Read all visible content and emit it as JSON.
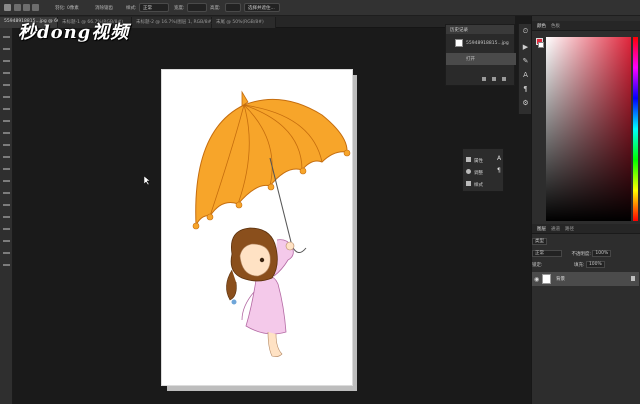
{
  "options_bar": {
    "items": [
      "羽化: 0像素",
      "消除锯齿",
      "样式:",
      "正常",
      "宽度:",
      "高度:",
      "选择并遮住..."
    ],
    "style_value": "正常",
    "refine_button": "选择并遮住..."
  },
  "doc_tabs": [
    "55948918815...jpg @ 66.7%(RGB/8#)",
    "未标题-1 @ 66.7%(RGB/8#)",
    "未标题-2 @ 16.7%(图层 1, RGB/8#)",
    "末尾 @ 50%(RGB/8#)"
  ],
  "watermark": "秒dong视频",
  "history_panel": {
    "title": "历史记录",
    "file_name": "55948918815...jpg",
    "step": "打开"
  },
  "float_panel": {
    "items": [
      {
        "label": "属性",
        "icon": "properties-icon"
      },
      {
        "label": "调整",
        "icon": "adjustments-icon"
      },
      {
        "label": "样式",
        "icon": "styles-icon"
      }
    ]
  },
  "right_panel": {
    "color_tabs": [
      "颜色",
      "色板"
    ],
    "layer_tabs": [
      "图层",
      "通道",
      "路径"
    ],
    "kind_label": "类型",
    "blend_mode": "正常",
    "opacity_label": "不透明度:",
    "opacity_value": "100%",
    "lock_label": "锁定:",
    "fill_label": "填充:",
    "fill_value": "100%",
    "layer_name": "背景"
  },
  "colors": {
    "foreground": "#e02a3e",
    "background": "#ffffff",
    "umbrella": "#f7a52a",
    "dress": "#f4c9ea",
    "hair": "#8a4f1c"
  }
}
